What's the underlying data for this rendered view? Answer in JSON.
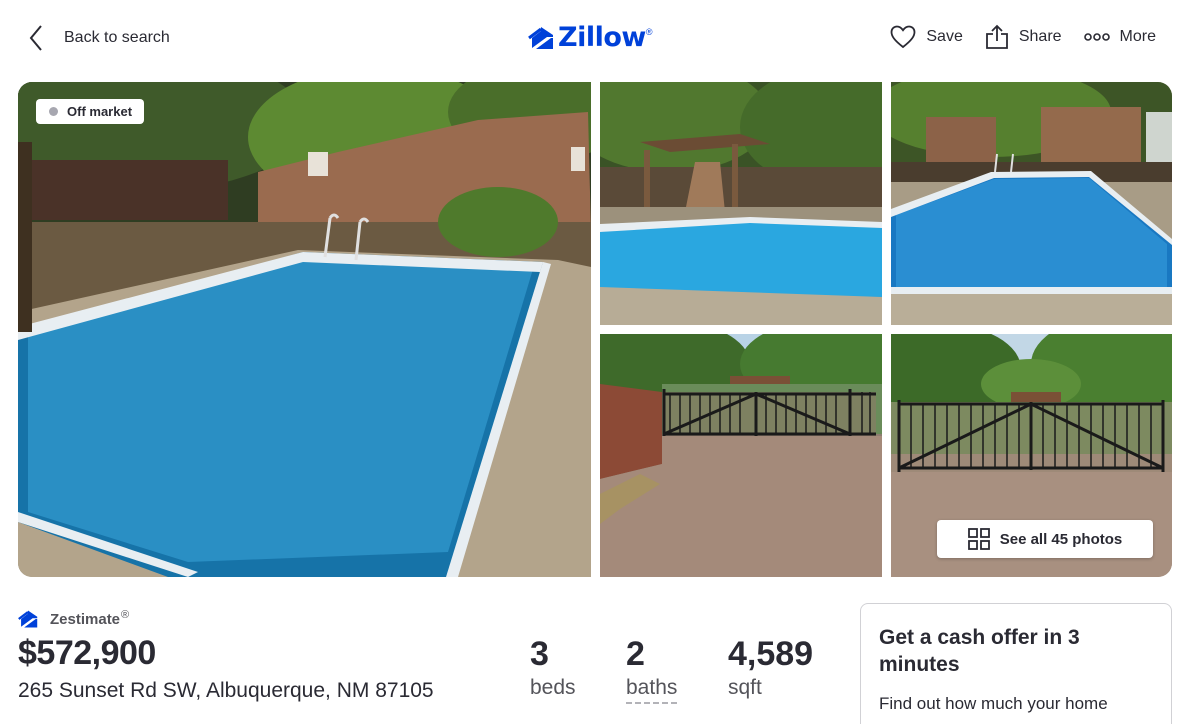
{
  "header": {
    "back_label": "Back to search",
    "logo_text": "Zillow",
    "actions": {
      "save": "Save",
      "share": "Share",
      "more": "More"
    }
  },
  "gallery": {
    "status_badge": "Off market",
    "see_all_label": "See all 45 photos"
  },
  "listing": {
    "zestimate_label": "Zestimate",
    "zestimate_mark": "®",
    "price": "$572,900",
    "address": "265 Sunset Rd SW, Albuquerque, NM 87105",
    "beds": {
      "value": "3",
      "label": "beds"
    },
    "baths": {
      "value": "2",
      "label": "baths"
    },
    "sqft": {
      "value": "4,589",
      "label": "sqft"
    }
  },
  "cash_offer": {
    "title": "Get a cash offer in 3 minutes",
    "subtitle": "Find out how much your home"
  },
  "colors": {
    "brand": "#0041d9",
    "text": "#2a2a33",
    "muted": "#54545a"
  },
  "icons": [
    "chevron-left-icon",
    "zillow-logo-icon",
    "heart-icon",
    "share-icon",
    "more-dots-icon",
    "status-dot-icon",
    "grid-icon",
    "zestimate-logo-icon"
  ]
}
